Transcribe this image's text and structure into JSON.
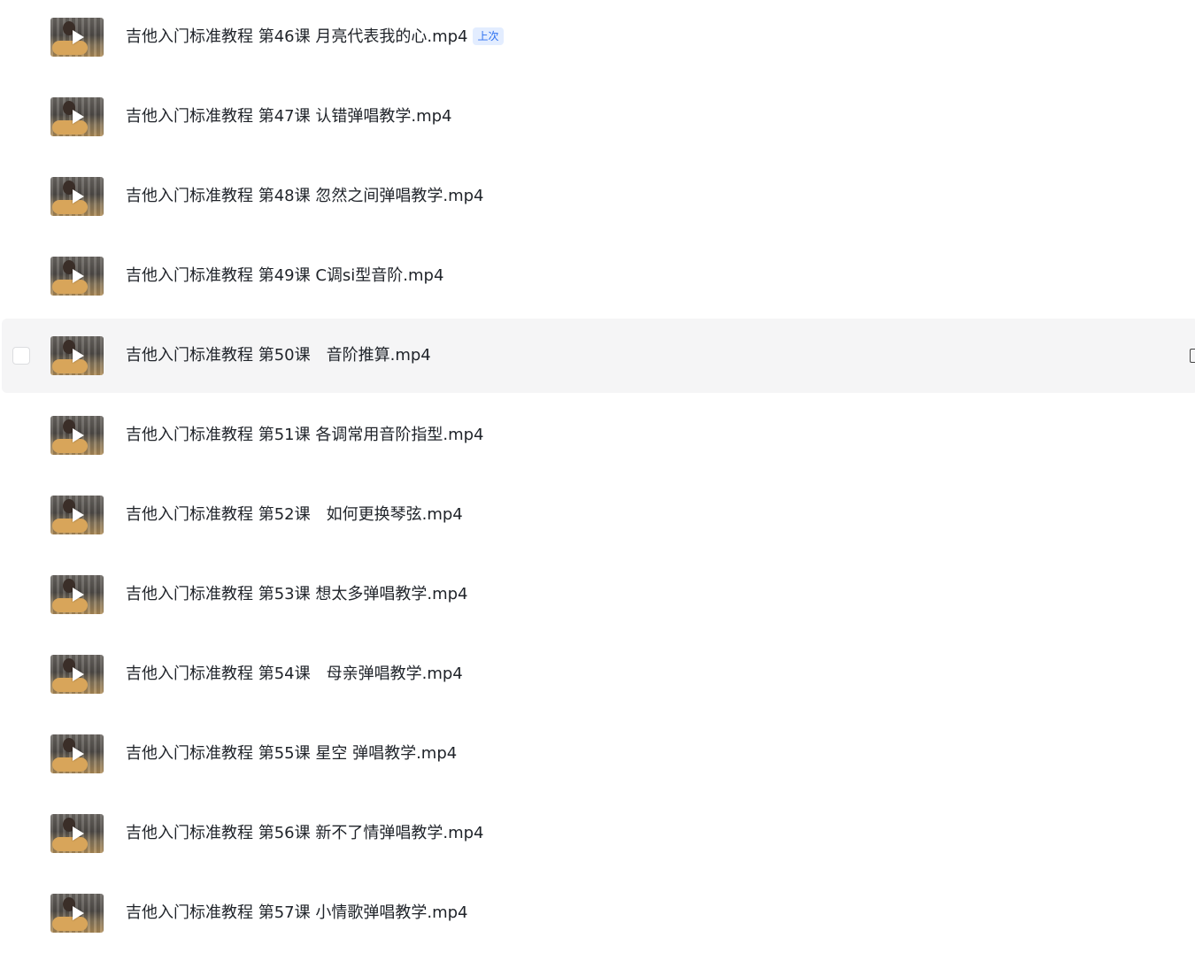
{
  "files": [
    {
      "name": "吉他入门标准教程 第46课 月亮代表我的心.mp4",
      "badge": "上次"
    },
    {
      "name": "吉他入门标准教程 第47课 认错弹唱教学.mp4"
    },
    {
      "name": "吉他入门标准教程 第48课 忽然之间弹唱教学.mp4"
    },
    {
      "name": "吉他入门标准教程 第49课 C调si型音阶.mp4"
    },
    {
      "name": "吉他入门标准教程 第50课　音阶推算.mp4",
      "hovered": true
    },
    {
      "name": "吉他入门标准教程 第51课 各调常用音阶指型.mp4"
    },
    {
      "name": "吉他入门标准教程 第52课　如何更换琴弦.mp4"
    },
    {
      "name": "吉他入门标准教程 第53课 想太多弹唱教学.mp4"
    },
    {
      "name": "吉他入门标准教程 第54课　母亲弹唱教学.mp4"
    },
    {
      "name": "吉他入门标准教程 第55课 星空 弹唱教学.mp4"
    },
    {
      "name": "吉他入门标准教程 第56课 新不了情弹唱教学.mp4"
    },
    {
      "name": "吉他入门标准教程 第57课 小情歌弹唱教学.mp4"
    }
  ]
}
